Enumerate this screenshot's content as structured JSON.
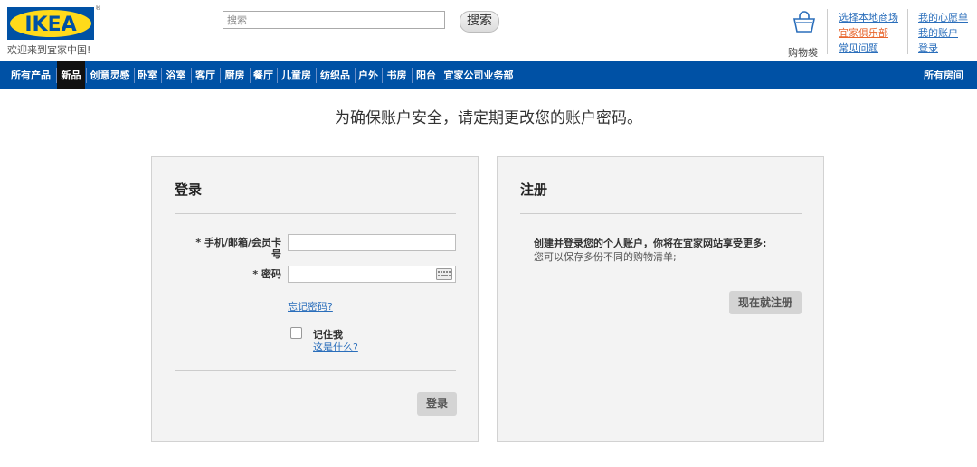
{
  "header": {
    "logo_text": "IKEA",
    "welcome": "欢迎来到宜家中国!",
    "search": {
      "placeholder": "搜索",
      "button_label": "搜索"
    },
    "cart_label": "购物袋",
    "links": {
      "choose_store": "选择本地商场",
      "family_club": "宜家俱乐部",
      "faq": "常见问题",
      "wishlist": "我的心愿单",
      "account": "我的账户",
      "login": "登录"
    },
    "brand_colors": {
      "blue": "#0051a5",
      "yellow": "#ffda1a"
    }
  },
  "nav": {
    "items": [
      "所有产品",
      "新品",
      "创意灵感",
      "卧室",
      "浴室",
      "客厅",
      "厨房",
      "餐厅",
      "儿童房",
      "纺织品",
      "户外",
      "书房",
      "阳台",
      "宜家公司业务部"
    ],
    "active": "新品",
    "right_item": "所有房间"
  },
  "notice": "为确保账户安全，请定期更改您的账户密码。",
  "login": {
    "title": "登录",
    "account_label_line1": "* 手机/邮箱/会员卡",
    "account_label_line2": "号",
    "account_value": "",
    "password_label": "* 密码",
    "password_value": "",
    "forgot_link": "忘记密码?",
    "remember_label": "记住我",
    "what_is_this": "这是什么?",
    "remember_checked": false,
    "button_label": "登录"
  },
  "register": {
    "title": "注册",
    "heading": "创建并登录您的个人账户，你将在宜家网站享受更多:",
    "benefit": "您可以保存多份不同的购物清单;",
    "button_label": "现在就注册"
  }
}
